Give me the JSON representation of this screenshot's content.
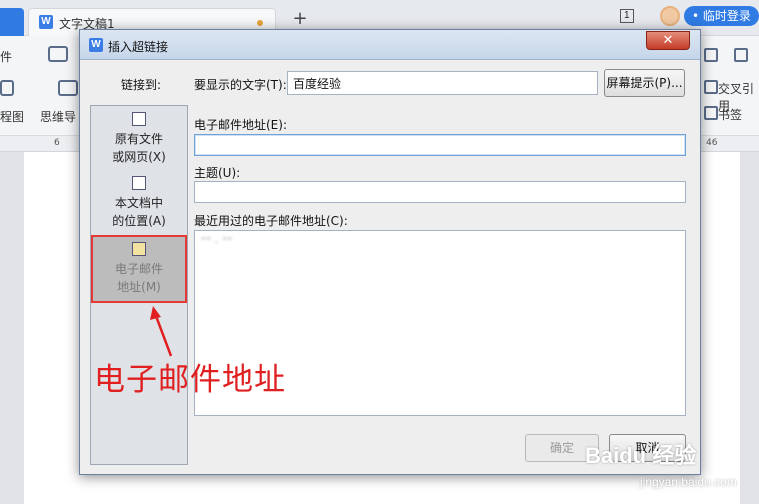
{
  "app": {
    "doc_tab_title": "文字文稿1",
    "new_tab_symbol": "+",
    "page_count": "1",
    "login_label": "• 临时登录"
  },
  "toolbar": {
    "left_items": [
      "件",
      "程图",
      "思维导"
    ],
    "right_items": [
      "交叉引用",
      "书签"
    ]
  },
  "ruler": {
    "numbers": [
      "6",
      "46"
    ]
  },
  "dialog": {
    "title": "插入超链接",
    "close_symbol": "✕",
    "link_to_label": "链接到:",
    "display_text_label": "要显示的文字(T):",
    "display_text_value": "百度经验",
    "screen_tip_button": "屏幕提示(P)...",
    "sidebar": [
      {
        "line1": "原有文件",
        "line2": "或网页(X)"
      },
      {
        "line1": "本文档中",
        "line2": "的位置(A)"
      },
      {
        "line1": "电子邮件",
        "line2": "地址(M)"
      }
    ],
    "email_label": "电子邮件地址(E):",
    "email_value": "",
    "subject_label": "主题(U):",
    "subject_value": "",
    "recent_label": "最近用过的电子邮件地址(C):",
    "recent_items": [
      "\"\" - \"\"   "
    ],
    "ok_button": "确定",
    "cancel_button": "取消"
  },
  "annotation": {
    "text": "电子邮件地址"
  },
  "watermark": {
    "brand": "Baidu 经验",
    "url": "jingyan.baidu.com"
  },
  "colors": {
    "accent": "#2f7be3",
    "annotation": "#e02020",
    "dialog_bg": "#eeeeee",
    "close_button": "#c43c28"
  }
}
